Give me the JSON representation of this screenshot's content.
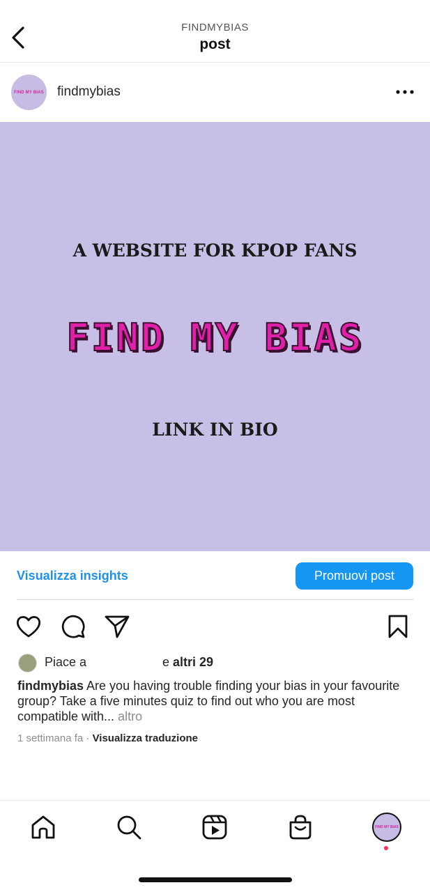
{
  "header": {
    "subtitle": "FINDMYBIAS",
    "title": "post"
  },
  "post": {
    "username": "findmybias",
    "avatar_logo_text": "FIND MY BIAS",
    "image": {
      "tagline": "A WEBSITE FOR KPOP FANS",
      "logo": "FIND MY BIAS",
      "link_text": "LINK IN BIO",
      "background": "#c7bfe5",
      "logo_color": "#e020a8"
    }
  },
  "insights": {
    "link_label": "Visualizza insights",
    "promote_label": "Promuovi post",
    "accent": "#1596f3"
  },
  "actions": {
    "like_icon": "heart-icon",
    "comment_icon": "comment-icon",
    "share_icon": "send-icon",
    "save_icon": "bookmark-icon"
  },
  "likes": {
    "prefix": "Piace a",
    "conjunction": "e",
    "others": "altri 29"
  },
  "caption": {
    "username": "findmybias",
    "text": "Are you having trouble finding your bias in your favourite group? Take a five minutes quiz to find out who you are most compatible with...",
    "more_label": "altro"
  },
  "meta": {
    "time": "1 settimana fa",
    "separator": "·",
    "translate_label": "Visualizza traduzione"
  },
  "tabbar": {
    "items": [
      "home-icon",
      "search-icon",
      "reels-icon",
      "shop-icon",
      "profile-avatar"
    ],
    "profile_logo_text": "FIND MY BIAS",
    "notification_color": "#ff2d55"
  }
}
